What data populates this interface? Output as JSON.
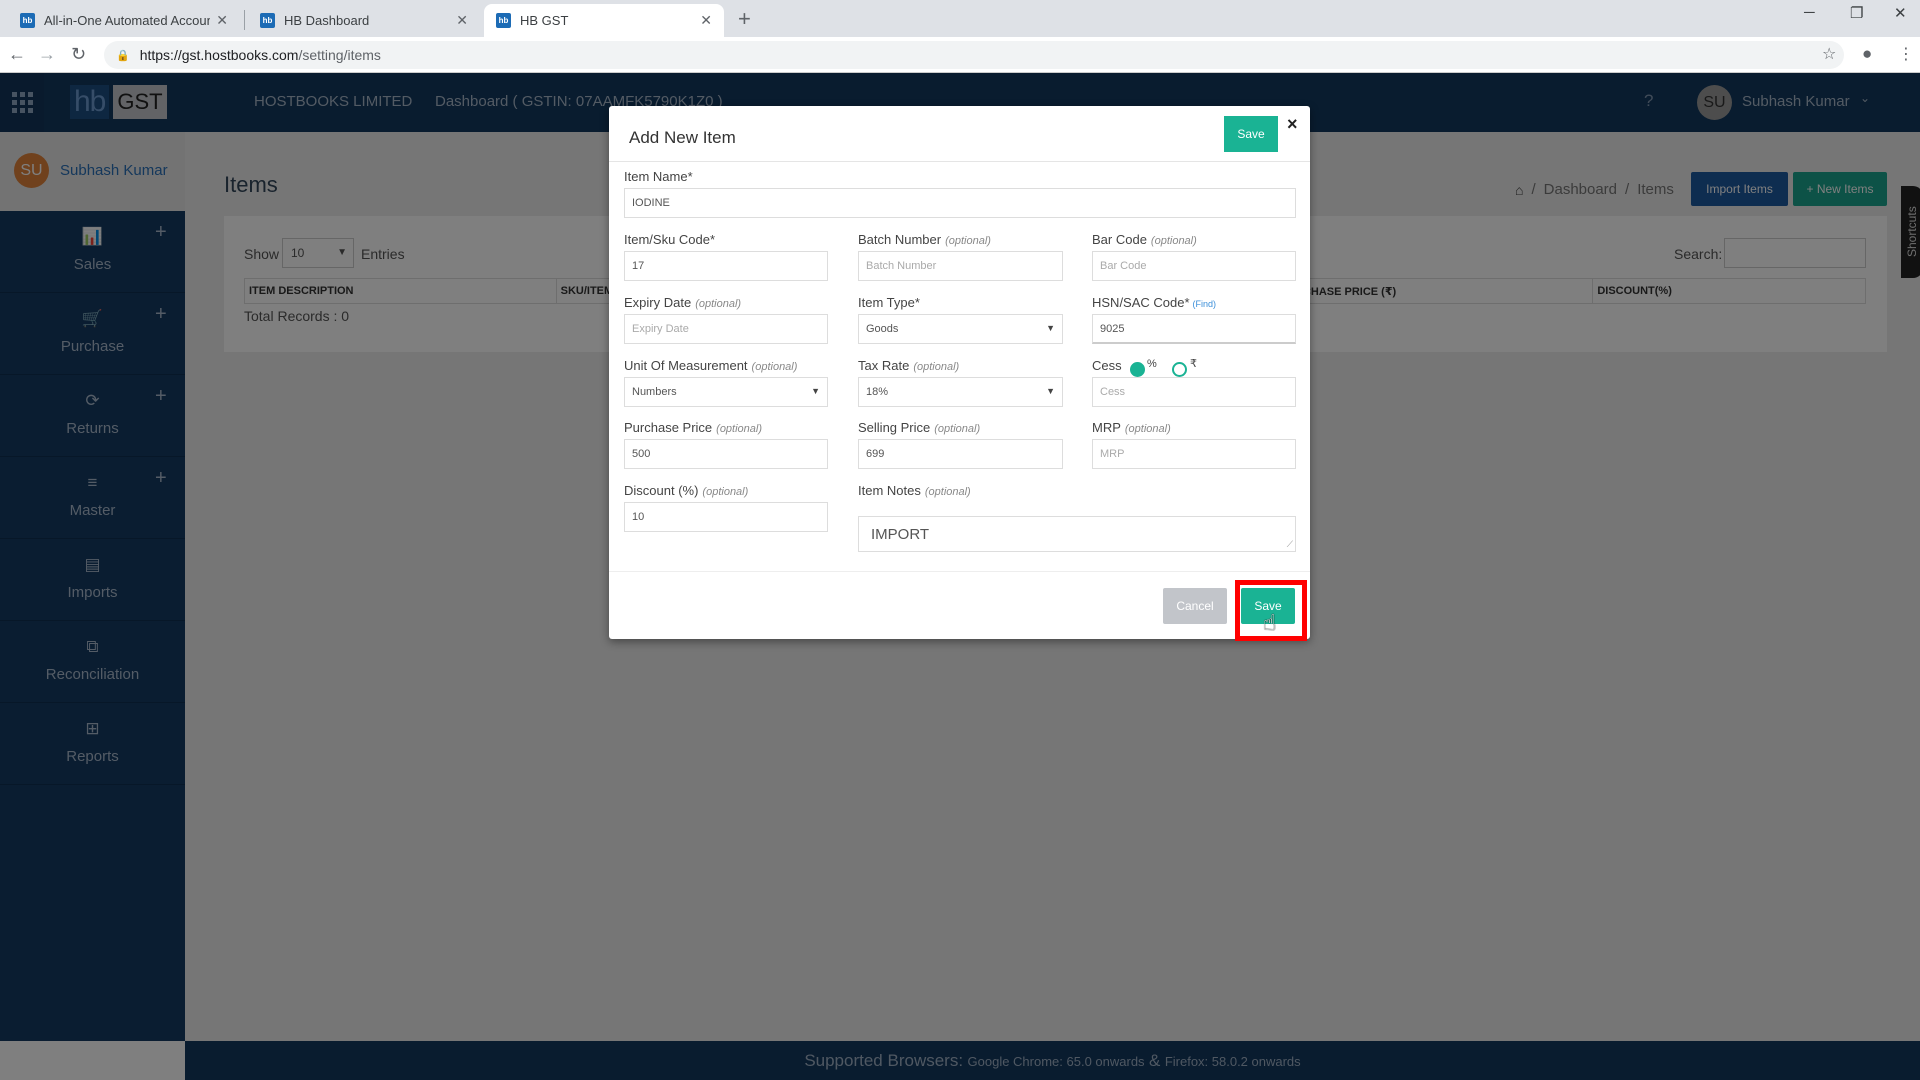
{
  "browser": {
    "tabs": [
      {
        "label": "All-in-One Automated Accountin",
        "favicon": "hb",
        "active": false
      },
      {
        "label": "HB Dashboard",
        "favicon": "hb",
        "active": false
      },
      {
        "label": "HB GST",
        "favicon": "hb",
        "active": true
      }
    ],
    "url_host": "https://gst.hostbooks.com",
    "url_path": "/setting/items",
    "window_controls": {
      "minimize": "─",
      "restore": "❐",
      "close": "✕"
    }
  },
  "header": {
    "logo_hb": "hb",
    "logo_gst": "GST",
    "company": "HOSTBOOKS LIMITED",
    "dashboard_label": "Dashboard ( GSTIN: 07AAMFK5790K1Z0 )",
    "help": "?",
    "avatar_initials": "SU",
    "user_name": "Subhash Kumar"
  },
  "sidebar": {
    "user_initials": "SU",
    "user_name": "Subhash Kumar",
    "items": [
      {
        "label": "Sales",
        "icon": "bar-chart-icon",
        "glyph": "📊",
        "has_add": true
      },
      {
        "label": "Purchase",
        "icon": "cart-icon",
        "glyph": "🛒",
        "has_add": true
      },
      {
        "label": "Returns",
        "icon": "refresh-icon",
        "glyph": "⟳",
        "has_add": true
      },
      {
        "label": "Master",
        "icon": "menu-icon",
        "glyph": "≡",
        "has_add": true
      },
      {
        "label": "Imports",
        "icon": "bookmark-book-icon",
        "glyph": "▤",
        "has_add": false
      },
      {
        "label": "Reconciliation",
        "icon": "copy-icon",
        "glyph": "⧉",
        "has_add": false
      },
      {
        "label": "Reports",
        "icon": "grid-icon",
        "glyph": "⊞",
        "has_add": false
      }
    ],
    "add_glyph": "+"
  },
  "page": {
    "title": "Items",
    "breadcrumb": [
      "Dashboard",
      "Items"
    ],
    "import_button": "Import Items",
    "new_button": "+ New Items",
    "show_label": "Show",
    "entries_value": "10",
    "entries_label": "Entries",
    "search_label": "Search:",
    "table_headers": [
      "ITEM DESCRIPTION",
      "SKU/ITEM CODE",
      "",
      "",
      "PURCHASE PRICE (₹)",
      "DISCOUNT(%)"
    ],
    "total_records": "Total Records : 0",
    "shortcuts_label": "Shortcuts"
  },
  "modal": {
    "title": "Add New Item",
    "save_label": "Save",
    "cancel_label": "Cancel",
    "close_glyph": "×",
    "fields": {
      "item_name": {
        "label": "Item Name*",
        "value": "IODINE"
      },
      "sku_code": {
        "label": "Item/Sku Code*",
        "value": "17"
      },
      "batch_number": {
        "label": "Batch Number",
        "optional": "(optional)",
        "placeholder": "Batch Number"
      },
      "bar_code": {
        "label": "Bar Code",
        "optional": "(optional)",
        "placeholder": "Bar Code"
      },
      "expiry_date": {
        "label": "Expiry Date",
        "optional": "(optional)",
        "placeholder": "Expiry Date"
      },
      "item_type": {
        "label": "Item Type*",
        "value": "Goods"
      },
      "hsn_code": {
        "label": "HSN/SAC Code*",
        "find_link": "(Find)",
        "value": "9025"
      },
      "uom": {
        "label": "Unit Of Measurement",
        "optional": "(optional)",
        "value": "Numbers"
      },
      "tax_rate": {
        "label": "Tax Rate",
        "optional": "(optional)",
        "value": "18%"
      },
      "cess": {
        "label": "Cess",
        "option_percent": "%",
        "option_rupee": "₹",
        "selected": "%",
        "placeholder": "Cess"
      },
      "purchase_price": {
        "label": "Purchase Price",
        "optional": "(optional)",
        "value": "500"
      },
      "selling_price": {
        "label": "Selling Price",
        "optional": "(optional)",
        "value": "699"
      },
      "mrp": {
        "label": "MRP",
        "optional": "(optional)",
        "placeholder": "MRP"
      },
      "discount": {
        "label": "Discount (%)",
        "optional": "(optional)",
        "value": "10"
      },
      "item_notes": {
        "label": "Item Notes",
        "optional": "(optional)",
        "value": "IMPORT"
      }
    }
  },
  "footer": {
    "lead": "Supported Browsers:",
    "chrome": "Google Chrome: 65.0 onwards",
    "amp": "&",
    "firefox": "Firefox: 58.0.2 onwards"
  },
  "colors": {
    "navy": "#13385e",
    "teal": "#1ab394",
    "import_blue": "#1c5aa0",
    "highlight_red": "#ff0000"
  }
}
